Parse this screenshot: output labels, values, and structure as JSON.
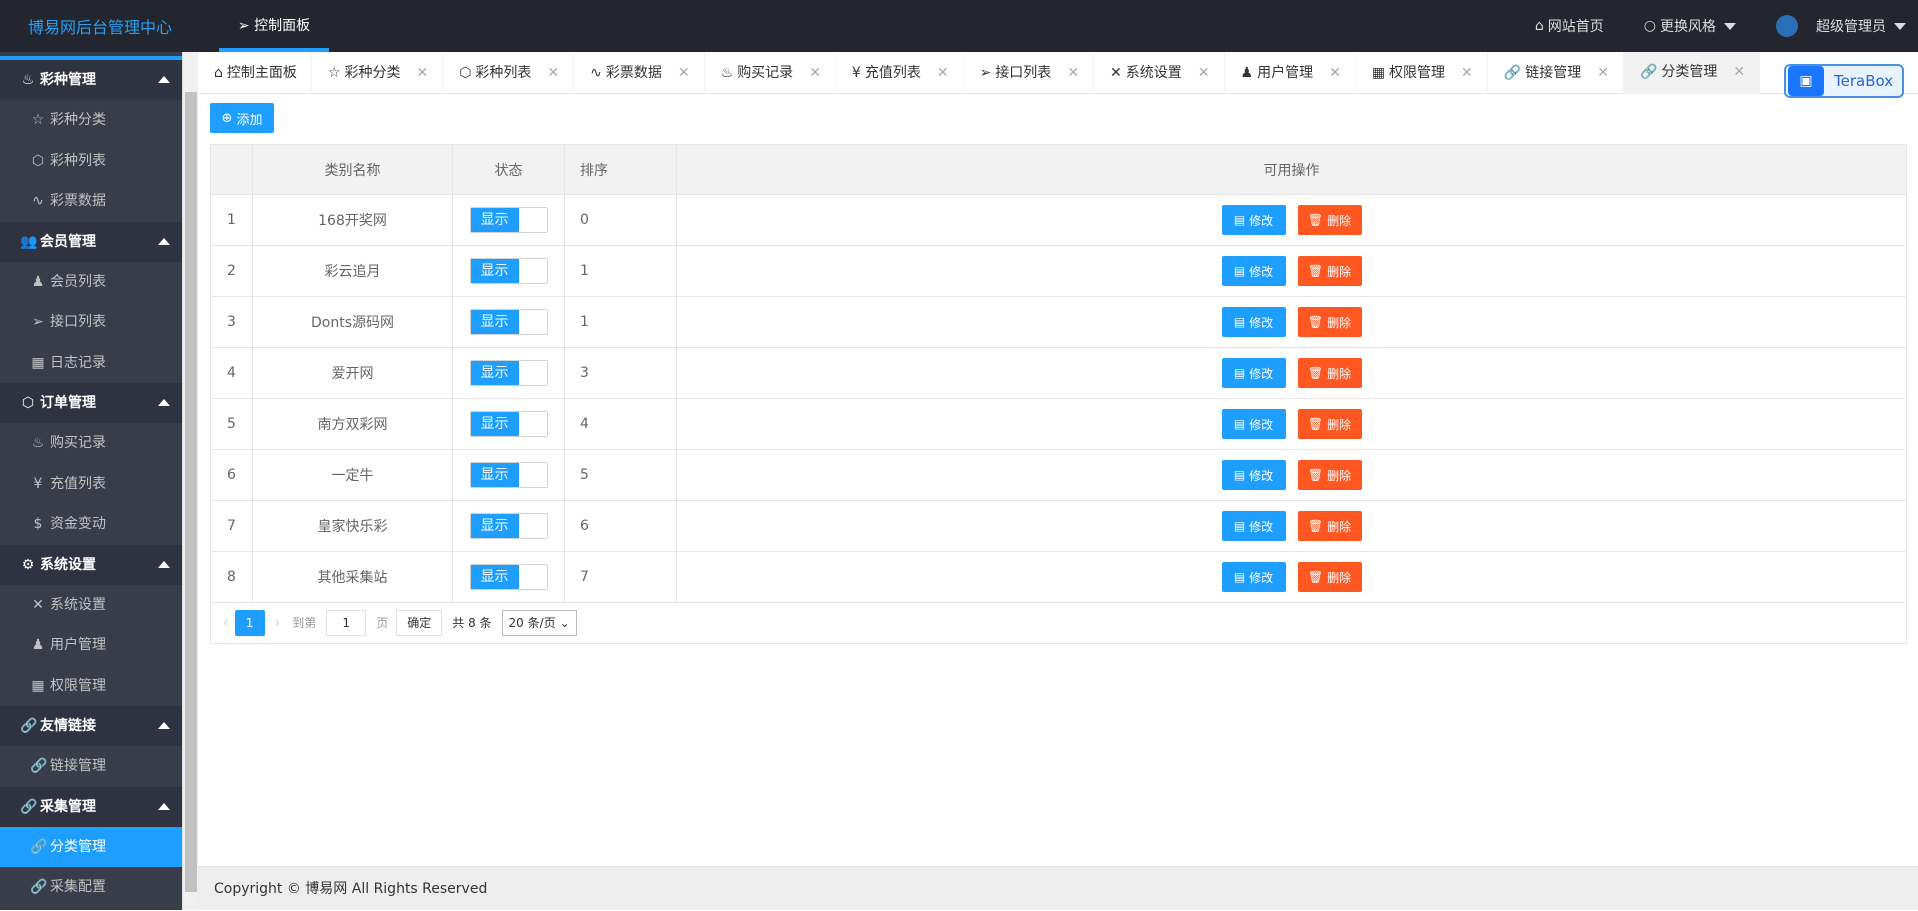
{
  "header": {
    "brand": "博易网后台管理中心",
    "nav_active": "控制面板",
    "links": [
      "网站首页",
      "更换风格",
      "超级管理员"
    ]
  },
  "sidebar": {
    "groups": [
      {
        "title": "彩种管理",
        "items": [
          "彩种分类",
          "彩种列表",
          "彩票数据"
        ]
      },
      {
        "title": "会员管理",
        "items": [
          "会员列表",
          "接口列表",
          "日志记录"
        ]
      },
      {
        "title": "订单管理",
        "items": [
          "购买记录",
          "充值列表",
          "资金变动"
        ]
      },
      {
        "title": "系统设置",
        "items": [
          "系统设置",
          "用户管理",
          "权限管理"
        ]
      },
      {
        "title": "友情链接",
        "items": [
          "链接管理"
        ]
      },
      {
        "title": "采集管理",
        "items": [
          "分类管理",
          "采集配置"
        ]
      }
    ],
    "active_item": "分类管理"
  },
  "tabs": [
    "控制主面板",
    "彩种分类",
    "彩种列表",
    "彩票数据",
    "购买记录",
    "充值列表",
    "接口列表",
    "系统设置",
    "用户管理",
    "权限管理",
    "链接管理",
    "分类管理"
  ],
  "active_tab": "分类管理",
  "terabox": "TeraBox",
  "toolbar": {
    "add_label": "添加"
  },
  "table": {
    "headers": [
      "",
      "类别名称",
      "状态",
      "排序",
      "可用操作"
    ],
    "rows": [
      {
        "no": "1",
        "name": "168开奖网",
        "status": "显示",
        "sort": "0"
      },
      {
        "no": "2",
        "name": "彩云追月",
        "status": "显示",
        "sort": "1"
      },
      {
        "no": "3",
        "name": "Donts源码网",
        "status": "显示",
        "sort": "1"
      },
      {
        "no": "4",
        "name": "爱开网",
        "status": "显示",
        "sort": "3"
      },
      {
        "no": "5",
        "name": "南方双彩网",
        "status": "显示",
        "sort": "4"
      },
      {
        "no": "6",
        "name": "一定牛",
        "status": "显示",
        "sort": "5"
      },
      {
        "no": "7",
        "name": "皇家快乐彩",
        "status": "显示",
        "sort": "6"
      },
      {
        "no": "8",
        "name": "其他采集站",
        "status": "显示",
        "sort": "7"
      }
    ],
    "edit_label": "修改",
    "delete_label": "删除"
  },
  "pager": {
    "current": "1",
    "goto_label": "到第",
    "goto_value": "1",
    "page_label": "页",
    "confirm": "确定",
    "total": "共 8 条",
    "per_page": "20 条/页"
  },
  "footer": "Copyright © 博易网 All Rights Reserved",
  "colors": {
    "accent": "#1e9fff",
    "danger": "#ff5722",
    "header_bg": "#23262e",
    "sidebar_bg": "#393d49"
  }
}
